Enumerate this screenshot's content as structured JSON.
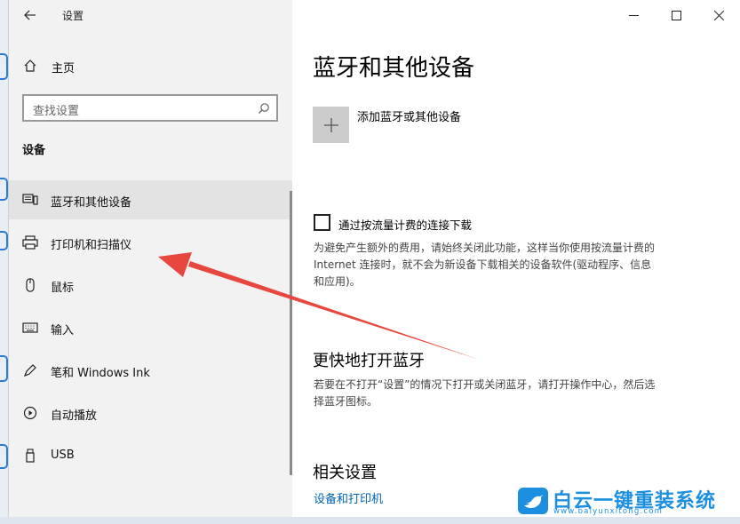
{
  "window": {
    "title": "设置",
    "controls": {
      "minimize_icon": "minimize-icon",
      "maximize_icon": "maximize-icon",
      "close_icon": "close-icon"
    }
  },
  "sidebar": {
    "home_label": "主页",
    "search_placeholder": "查找设置",
    "section_title": "设备",
    "items": [
      {
        "label": "蓝牙和其他设备",
        "icon": "bluetooth-devices-icon",
        "active": true
      },
      {
        "label": "打印机和扫描仪",
        "icon": "printer-icon",
        "active": false
      },
      {
        "label": "鼠标",
        "icon": "mouse-icon",
        "active": false
      },
      {
        "label": "输入",
        "icon": "keyboard-icon",
        "active": false
      },
      {
        "label": "笔和 Windows Ink",
        "icon": "pen-icon",
        "active": false
      },
      {
        "label": "自动播放",
        "icon": "autoplay-icon",
        "active": false
      },
      {
        "label": "USB",
        "icon": "usb-icon",
        "active": false
      }
    ]
  },
  "main": {
    "title": "蓝牙和其他设备",
    "add_device_label": "添加蓝牙或其他设备",
    "metered": {
      "checkbox_label": "通过按流量计费的连接下载",
      "checked": false,
      "description_lines": [
        "为避免产生额外的费用，请始终关闭此功能，这样当你使用按流量计费的",
        "Internet 连接时，就不会为新设备下载相关的设备软件(驱动程序、信息",
        "和应用)。"
      ]
    },
    "quick_bt": {
      "heading": "更快地打开蓝牙",
      "description_lines": [
        "若要在不打开“设置”的情况下打开或关闭蓝牙，请打开操作中心，然后选",
        "择蓝牙图标。"
      ]
    },
    "related": {
      "heading": "相关设置",
      "link": "设备和打印机"
    }
  },
  "watermark": {
    "title": "白云一键重装系统",
    "url": "www.baiyunxitong.com"
  },
  "colors": {
    "accent": "#0063b1",
    "annotation_arrow": "#e8473f",
    "watermark": "#1d8fe1"
  }
}
